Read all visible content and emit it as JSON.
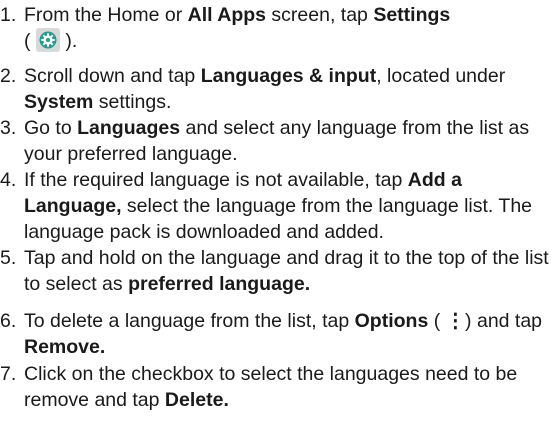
{
  "steps": [
    {
      "num": "1.",
      "parts": {
        "t1": "From the Home or ",
        "b1": "All Apps",
        "t2": " screen, tap ",
        "b2": "Settings",
        "t3": "(",
        "t4": ")."
      }
    },
    {
      "num": "2.",
      "parts": {
        "t1": "Scroll down and tap ",
        "b1": "Languages & input",
        "t2": ", located under ",
        "b2": "System",
        "t3": " settings."
      }
    },
    {
      "num": "3.",
      "parts": {
        "t1": "Go to ",
        "b1": "Languages",
        "t2": " and select any language from the list as your preferred language."
      }
    },
    {
      "num": "4.",
      "parts": {
        "t1": "If the required language is not available, tap ",
        "b1": "Add a Language,",
        "t2": " select the language from the language list. The language pack is downloaded and added."
      }
    },
    {
      "num": "5.",
      "parts": {
        "t1": "Tap and hold on the language and drag it to the top of the list to select as ",
        "b1": "preferred language."
      }
    },
    {
      "num": "6.",
      "parts": {
        "t1": "To delete a language from the list, tap ",
        "b1": "Options",
        "t2": " ( ",
        "icon": "⋮",
        "t3": " ) and tap ",
        "b2": "Remove."
      }
    },
    {
      "num": "7.",
      "parts": {
        "t1": "Click on the checkbox to select the languages need to be remove and tap ",
        "b1": "Delete."
      }
    }
  ],
  "icons": {
    "settings_bg": "#d9d9d9",
    "settings_teal": "#1b9e8f"
  }
}
